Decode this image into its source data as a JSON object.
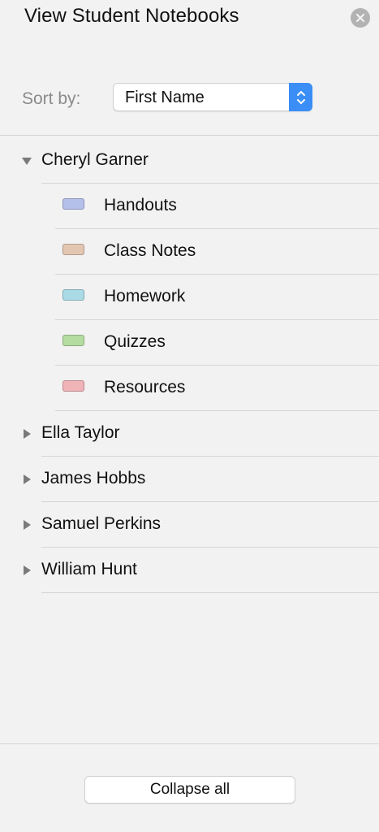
{
  "header": {
    "title": "View Student Notebooks",
    "close_icon": "close-icon"
  },
  "sort": {
    "label": "Sort by:",
    "selected": "First Name",
    "accent_color": "#3a8ef5"
  },
  "students": [
    {
      "name": "Cheryl Garner",
      "expanded": true,
      "sections": [
        {
          "name": "Handouts",
          "color": "#b4bfea"
        },
        {
          "name": "Class Notes",
          "color": "#e2c6b2"
        },
        {
          "name": "Homework",
          "color": "#a9dbe6"
        },
        {
          "name": "Quizzes",
          "color": "#b4dca0"
        },
        {
          "name": "Resources",
          "color": "#f0b3b8"
        }
      ]
    },
    {
      "name": "Ella Taylor",
      "expanded": false,
      "sections": []
    },
    {
      "name": "James Hobbs",
      "expanded": false,
      "sections": []
    },
    {
      "name": "Samuel Perkins",
      "expanded": false,
      "sections": []
    },
    {
      "name": "William Hunt",
      "expanded": false,
      "sections": []
    }
  ],
  "footer": {
    "collapse_label": "Collapse all"
  }
}
